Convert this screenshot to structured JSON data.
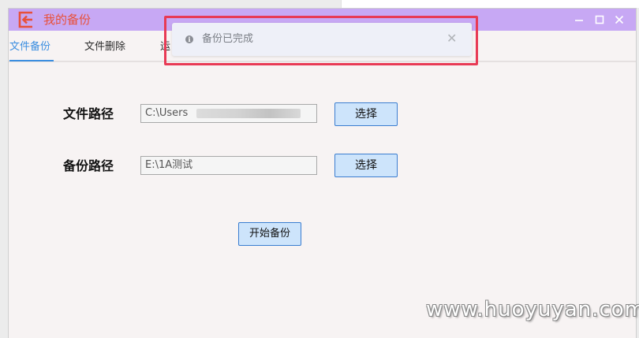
{
  "window": {
    "title": "我的备份"
  },
  "tabs": [
    {
      "label": "文件备份",
      "active": true
    },
    {
      "label": "文件删除",
      "active": false
    },
    {
      "label": "运",
      "active": false
    }
  ],
  "form": {
    "file_path_label": "文件路径",
    "file_path_value": "C:\\Users",
    "backup_path_label": "备份路径",
    "backup_path_value": "E:\\1A测试",
    "choose_label": "选择",
    "start_label": "开始备份"
  },
  "toast": {
    "message": "备份已完成",
    "close_glyph": "✕",
    "icon_glyph": "i"
  },
  "watermark": "www.huoyuyan.com",
  "colors": {
    "titlebar": "#c7a8f4",
    "title_text": "#e8503a",
    "accent": "#3b8ee0",
    "button_fill": "#cde4fb",
    "highlight": "#e83a55"
  }
}
